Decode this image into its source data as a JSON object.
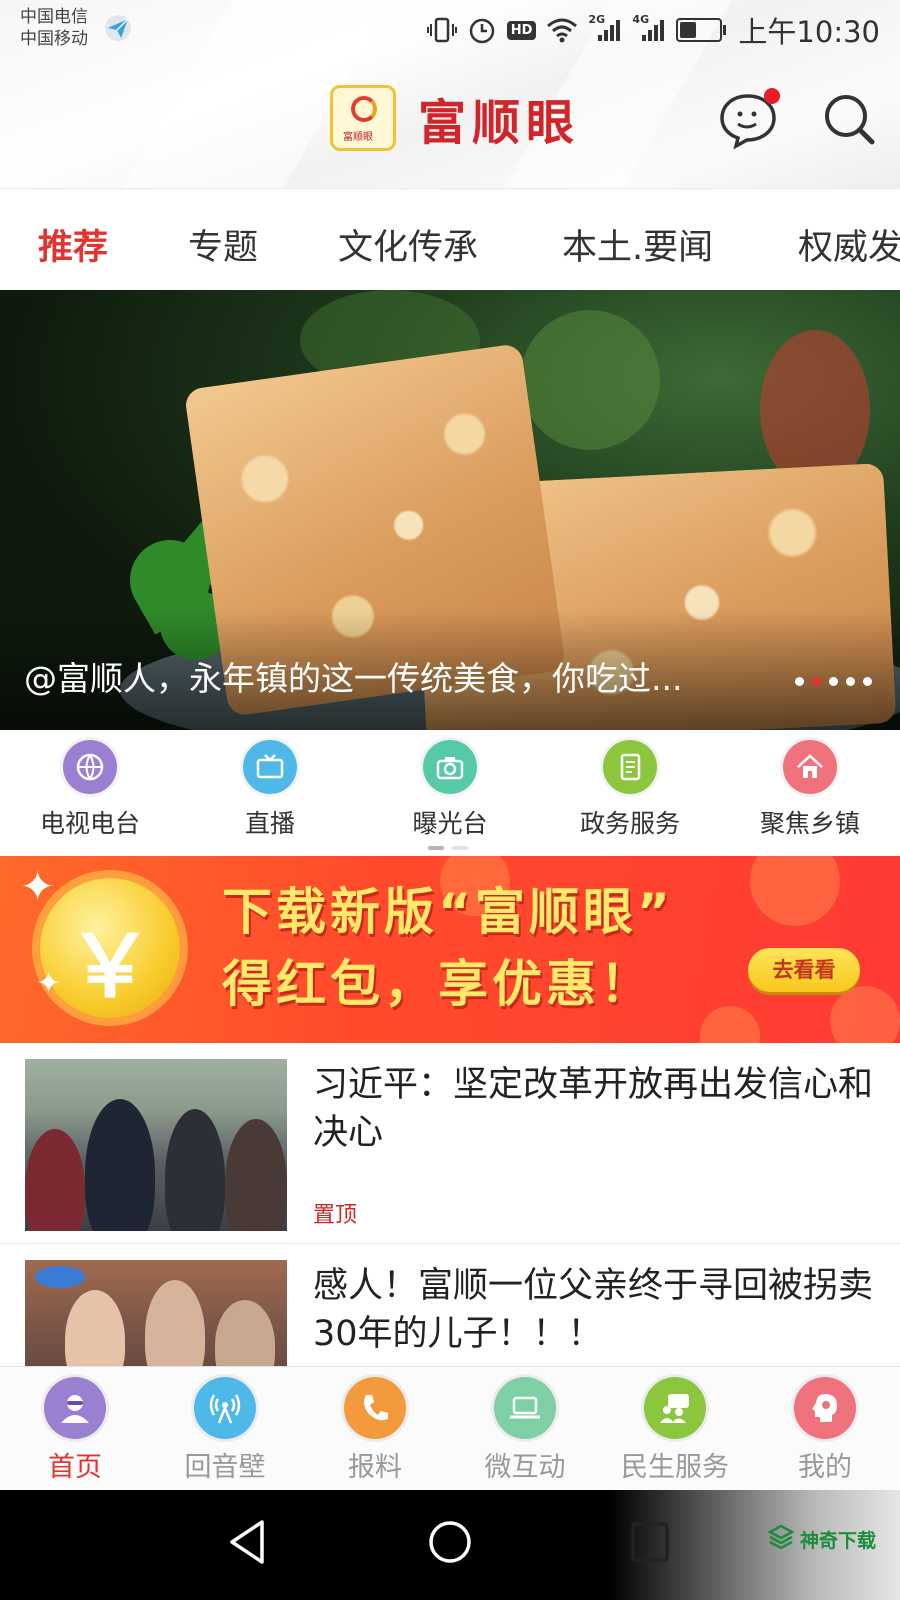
{
  "status_bar": {
    "carrier_1": "中国电信",
    "carrier_2": "中国移动",
    "hd": "HD",
    "sim1_label": "2G",
    "sim2_label": "4G",
    "time": "上午10:30"
  },
  "header": {
    "app_name": "富顺眼",
    "logo_text": "富顺眼",
    "has_unread_message": true
  },
  "tabs": [
    {
      "label": "推荐",
      "active": true
    },
    {
      "label": "专题",
      "active": false
    },
    {
      "label": "文化传承",
      "active": false
    },
    {
      "label": "本土.要闻",
      "active": false
    },
    {
      "label": "权威发",
      "active": false
    }
  ],
  "banner": {
    "caption": "@富顺人，永年镇的这一传统美食，你吃过...",
    "page_count": 5,
    "current_page": 2
  },
  "quick_entries": [
    {
      "label": "电视电台",
      "icon": "globe-icon",
      "color": "#9b7fd1"
    },
    {
      "label": "直播",
      "icon": "tv-icon",
      "color": "#4fb8e8"
    },
    {
      "label": "曝光台",
      "icon": "camera-icon",
      "color": "#56c9a6"
    },
    {
      "label": "政务服务",
      "icon": "document-icon",
      "color": "#8cc63f"
    },
    {
      "label": "聚焦乡镇",
      "icon": "home-icon",
      "color": "#f0727c"
    }
  ],
  "promo": {
    "line1": "下载新版“富顺眼”",
    "line2": "得红包，享优惠！",
    "coin_symbol": "￥",
    "button": "去看看"
  },
  "news": [
    {
      "title": "习近平：坚定改革开放再出发信心和决心",
      "tag": "置顶"
    },
    {
      "title": "感人！富顺一位父亲终于寻回被拐卖30年的儿子！！！",
      "tag": ""
    }
  ],
  "bottom_nav": [
    {
      "label": "首页",
      "icon": "user-icon",
      "color": "#9b7fd1",
      "active": true
    },
    {
      "label": "回音壁",
      "icon": "broadcast-icon",
      "color": "#4fb8e8",
      "active": false
    },
    {
      "label": "报料",
      "icon": "phone-icon",
      "color": "#f39a3c",
      "active": false
    },
    {
      "label": "微互动",
      "icon": "laptop-icon",
      "color": "#7fd0a4",
      "active": false
    },
    {
      "label": "民生服务",
      "icon": "chat-group-icon",
      "color": "#8cc63f",
      "active": false
    },
    {
      "label": "我的",
      "icon": "profile-icon",
      "color": "#f0727c",
      "active": false
    }
  ],
  "watermark": "神奇下载"
}
